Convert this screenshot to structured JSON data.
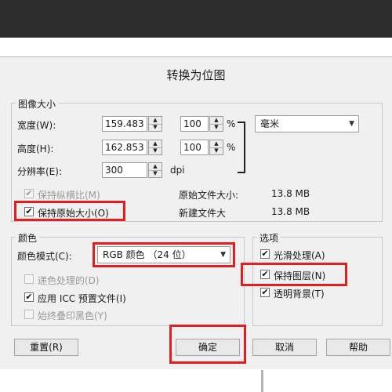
{
  "dialog": {
    "title": "转换为位图"
  },
  "image_size": {
    "group_title": "图像大小",
    "width_label": "宽度(W):",
    "width_value": "159.483",
    "width_percent": "100",
    "height_label": "高度(H):",
    "height_value": "162.853",
    "height_percent": "100",
    "percent_sign": "%",
    "unit": "毫米",
    "resolution_label": "分辨率(E):",
    "resolution_value": "300",
    "resolution_unit": "dpi",
    "keep_ratio_label": "保持纵横比(M)",
    "keep_ratio_checked": true,
    "keep_original_label": "保持原始大小(O)",
    "keep_original_checked": true,
    "original_size_label": "原始文件大小:",
    "original_size_value": "13.8 MB",
    "new_size_label": "新建文件大",
    "new_size_value": "13.8 MB"
  },
  "color": {
    "group_title": "颜色",
    "mode_label": "颜色模式(C):",
    "mode_value": "RGB 颜色 （24 位）",
    "dithered_label": "递色处理的(D)",
    "dithered_checked": false,
    "icc_label": "应用 ICC 预置文件(I)",
    "icc_checked": true,
    "overprint_label": "始终叠印黑色(Y)",
    "overprint_checked": false
  },
  "options": {
    "group_title": "选项",
    "smoothing_label": "光滑处理(A)",
    "smoothing_checked": true,
    "keep_layers_label": "保持图层(N)",
    "keep_layers_checked": true,
    "transparent_label": "透明背景(T)",
    "transparent_checked": true
  },
  "buttons": {
    "reset": "重置(R)",
    "ok": "确定",
    "cancel": "取消",
    "help": "帮助"
  },
  "icons": {
    "check": "✔",
    "spin_up": "▲",
    "spin_down": "▼",
    "dropdown": "▼"
  },
  "colors": {
    "highlight": "#e02020",
    "dialog_bg": "#f0f0f0",
    "top_bar": "#2d2d2d"
  }
}
